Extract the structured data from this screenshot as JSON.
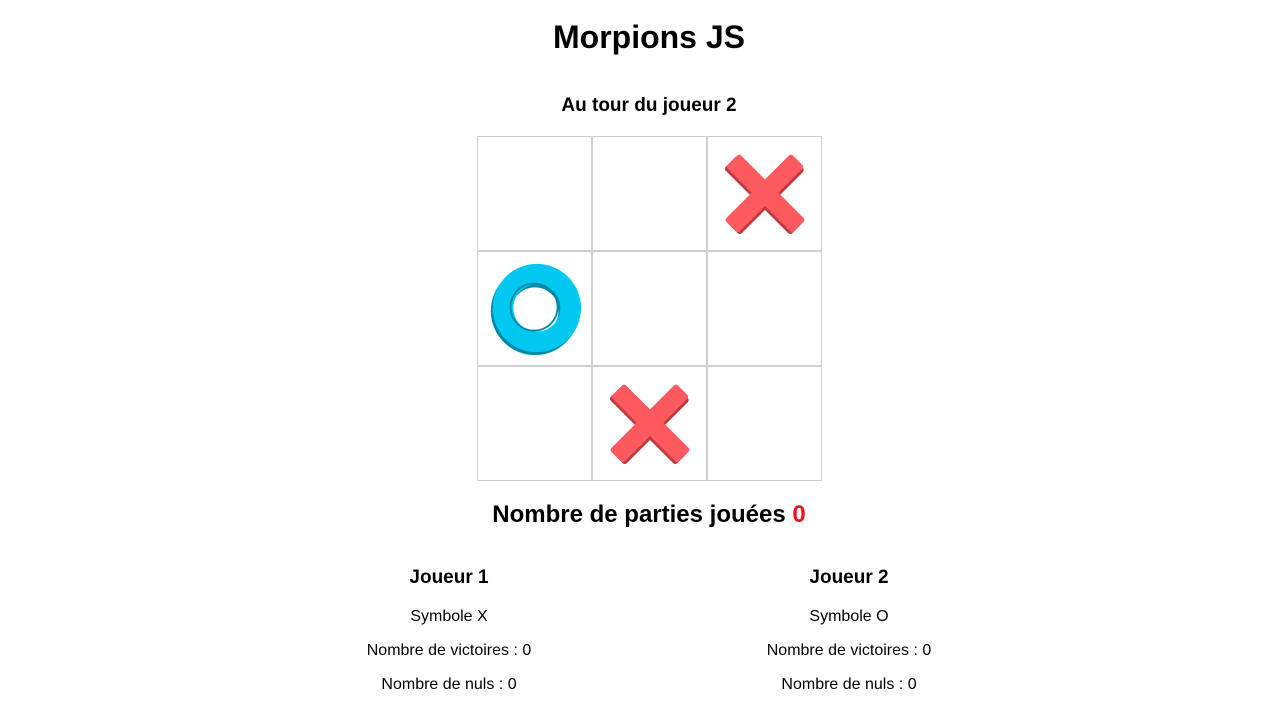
{
  "title": "Morpions JS",
  "turn_text": "Au tour du joueur 2",
  "board": [
    "",
    "",
    "X",
    "O",
    "",
    "",
    "",
    "X",
    ""
  ],
  "colors": {
    "x": "#ff5a5f",
    "x_shadow": "#c23a3f",
    "o": "#00c8f0",
    "o_shadow": "#0089a8",
    "count": "#e8141f"
  },
  "games": {
    "label": "Nombre de parties jouées",
    "count": "0"
  },
  "players": [
    {
      "name": "Joueur 1",
      "symbol": "Symbole X",
      "wins": "Nombre de victoires : 0",
      "draws": "Nombre de nuls : 0"
    },
    {
      "name": "Joueur 2",
      "symbol": "Symbole O",
      "wins": "Nombre de victoires : 0",
      "draws": "Nombre de nuls : 0"
    }
  ]
}
